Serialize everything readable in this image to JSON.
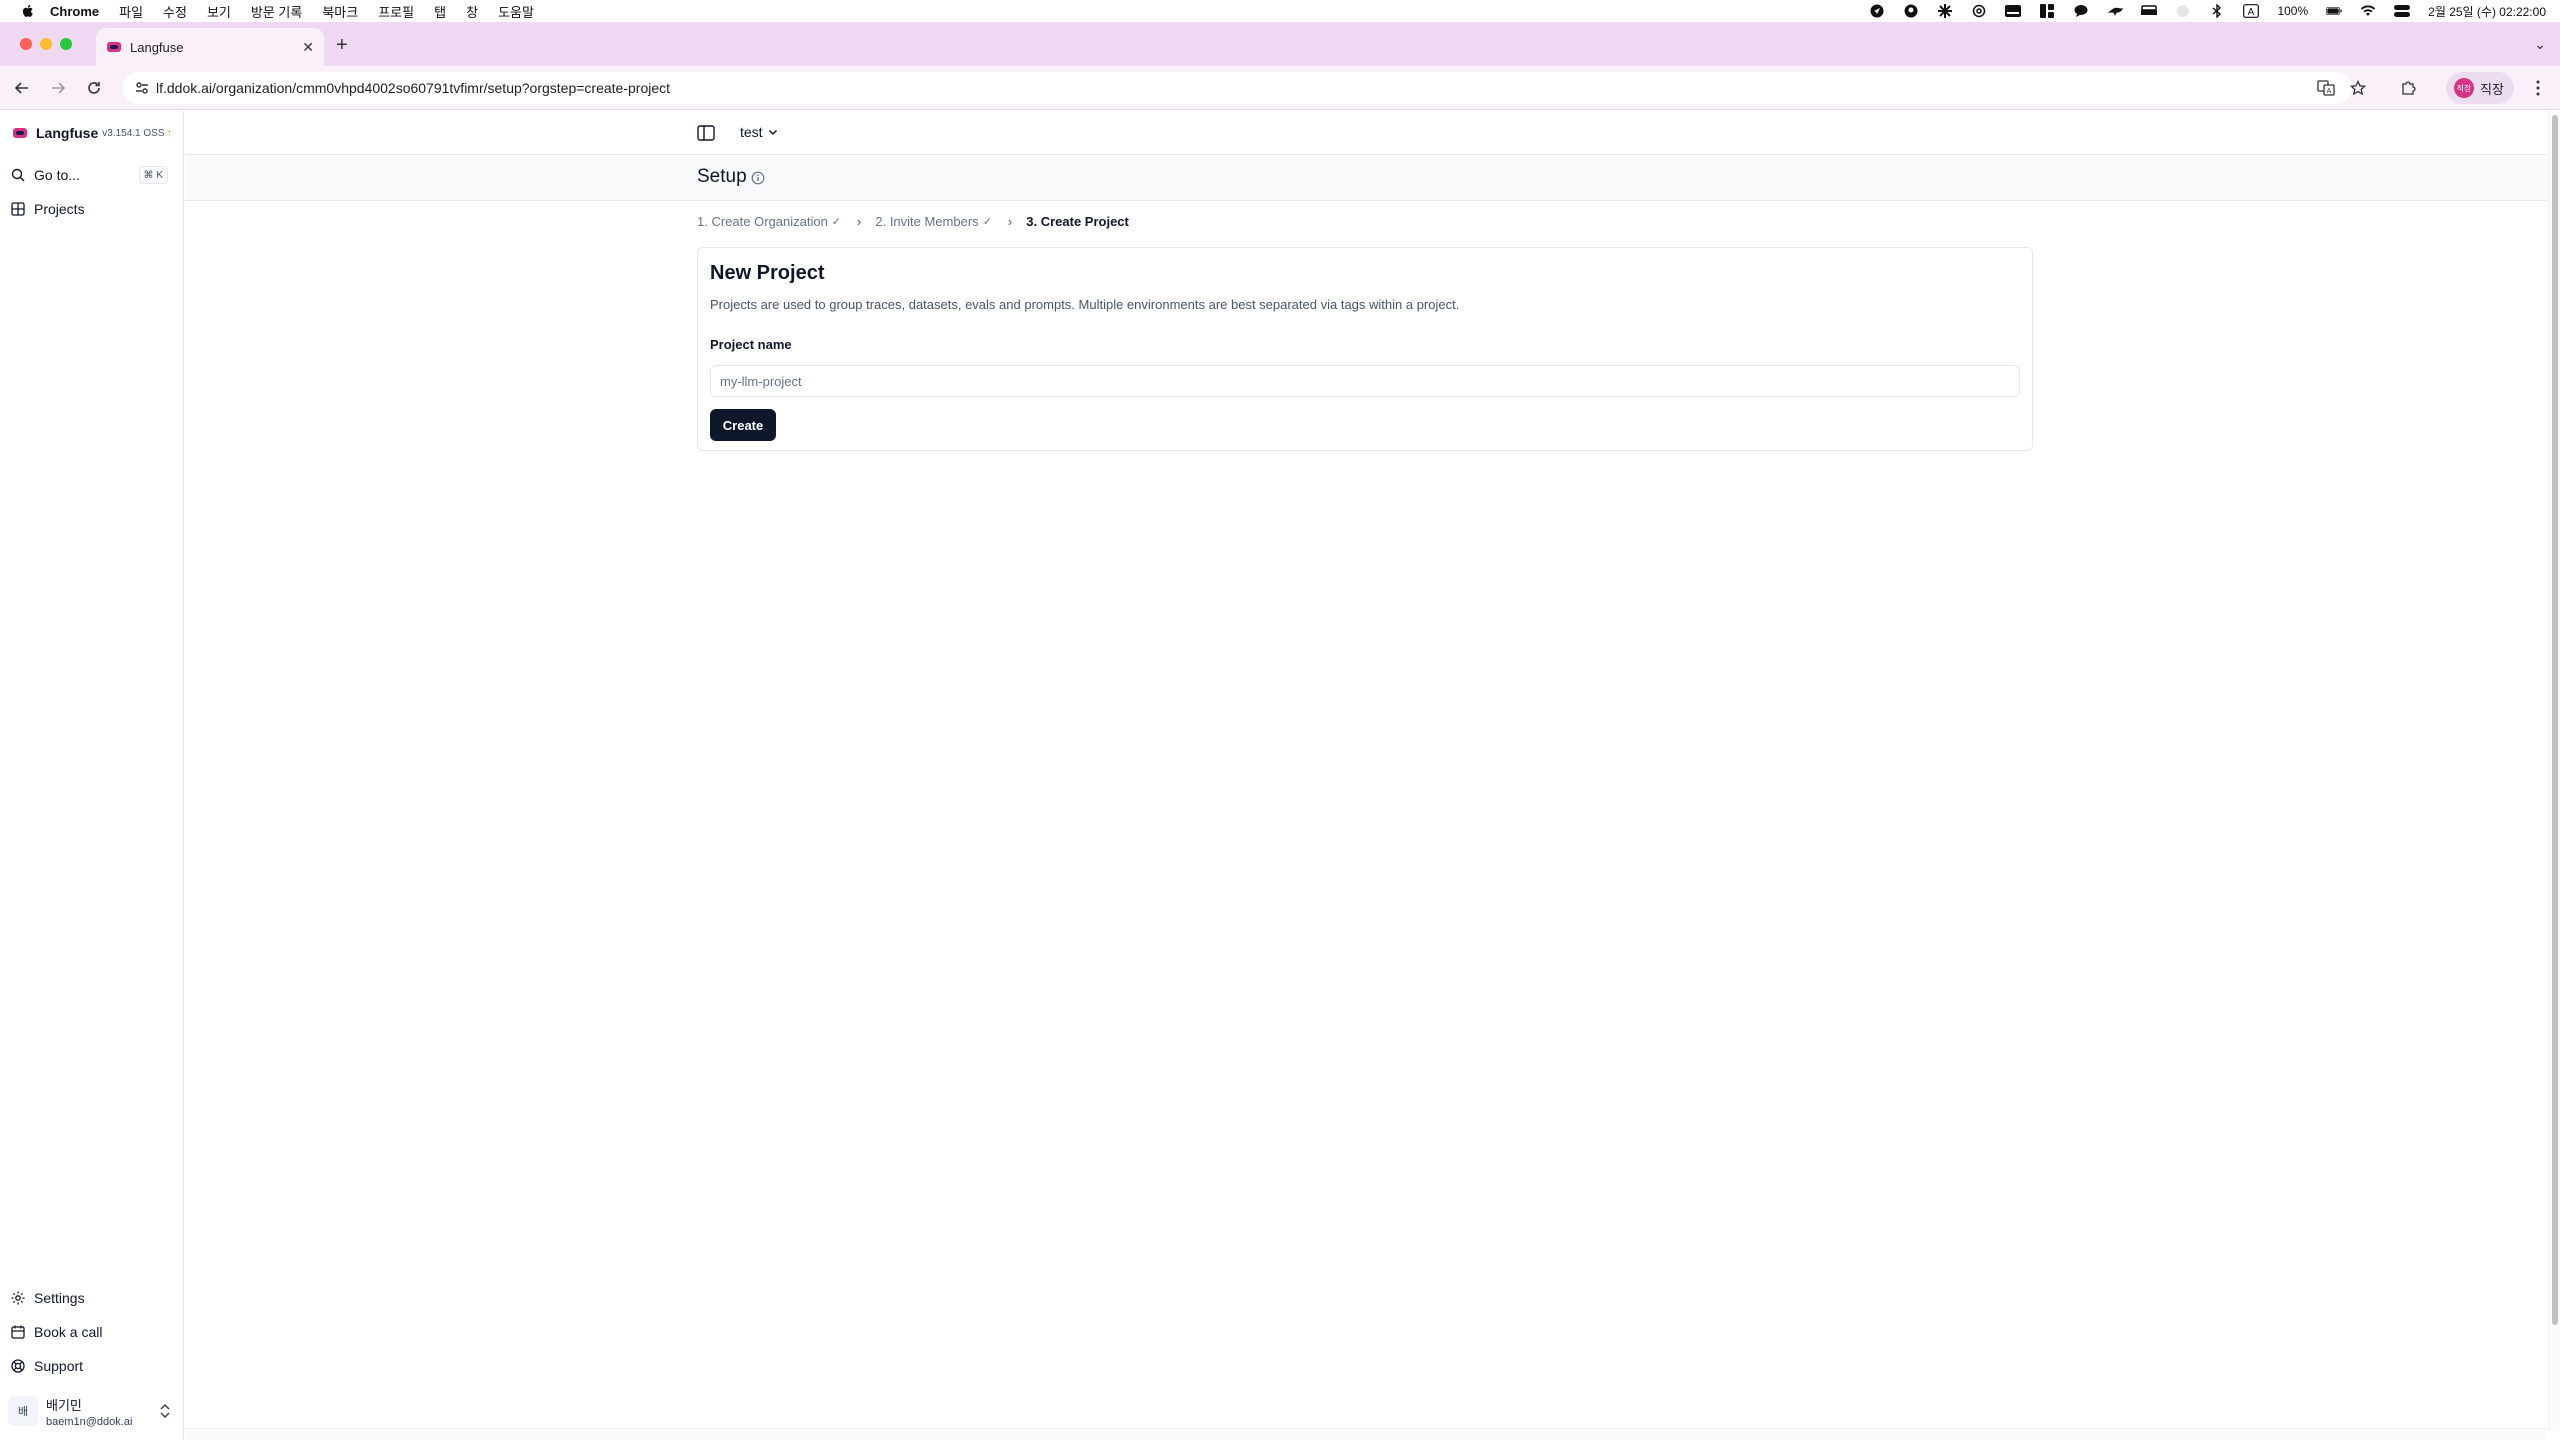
{
  "menubar": {
    "app": "Chrome",
    "items": [
      "파일",
      "수정",
      "보기",
      "방문 기록",
      "북마크",
      "프로필",
      "탭",
      "창",
      "도움말"
    ],
    "battery": "100%",
    "clock": "2월 25일 (수) 02:22:00"
  },
  "browser": {
    "tab_title": "Langfuse",
    "url": "lf.ddok.ai/organization/cmm0vhpd4002so60791tvfimr/setup?orgstep=create-project",
    "profile_label": "직장",
    "profile_avatar": "직장"
  },
  "sidebar": {
    "brand": "Langfuse",
    "version": "v3.154.1 OSS",
    "goto_label": "Go to...",
    "goto_shortcut": "⌘ K",
    "projects_label": "Projects",
    "settings_label": "Settings",
    "book_call_label": "Book a call",
    "support_label": "Support",
    "user_initial": "배",
    "user_name": "배기민",
    "user_email": "baem1n@ddok.ai"
  },
  "topbar": {
    "org_name": "test"
  },
  "page": {
    "title": "Setup",
    "steps": [
      "1. Create Organization",
      "2. Invite Members",
      "3. Create Project"
    ]
  },
  "form": {
    "title": "New Project",
    "description": "Projects are used to group traces, datasets, evals and prompts. Multiple environments are best separated via tags within a project.",
    "label": "Project name",
    "placeholder": "my-llm-project",
    "button": "Create"
  },
  "colors": {
    "tab_strip": "#efd9f2",
    "primary_button": "#0f172a",
    "muted_text": "#64748b",
    "brand_accent": "#d63384"
  }
}
